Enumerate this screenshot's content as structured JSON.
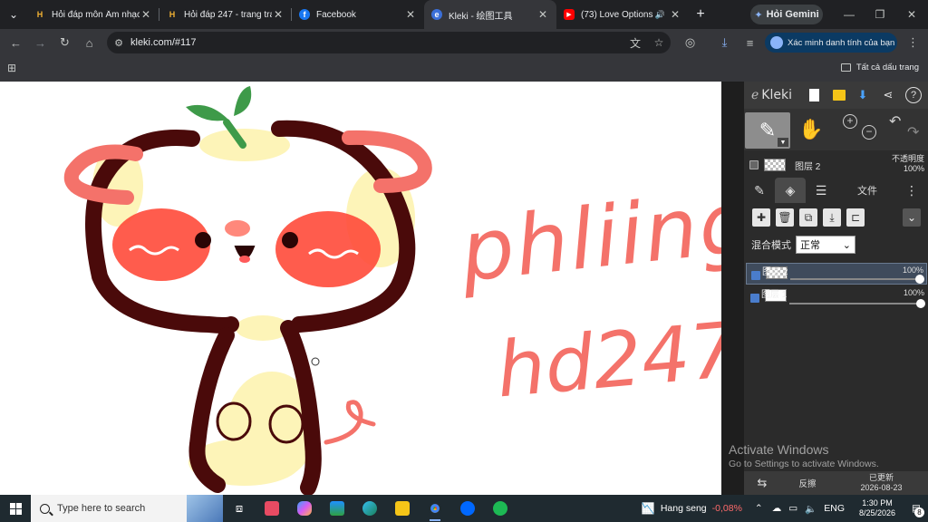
{
  "browser": {
    "tabs": [
      {
        "label": "Hỏi đáp môn Âm nhạc",
        "favicon": "hoidap-logo-icon"
      },
      {
        "label": "Hỏi đáp 247 - trang tra",
        "favicon": "hoidap-logo-icon"
      },
      {
        "label": "Facebook",
        "favicon": "facebook-icon"
      },
      {
        "label": "Kleki - 绘图工具",
        "favicon": "kleki-icon",
        "active": true
      },
      {
        "label": "(73) Love Options (",
        "favicon": "youtube-icon",
        "audio": true
      }
    ],
    "gemini_label": "Hỏi Gemini",
    "url": "kleki.com/#117",
    "verify_label": "Xác minh danh tính của bạn",
    "bookmarks_all": "Tất cả dấu trang"
  },
  "canvas": {
    "handwriting_line1": "phliing",
    "handwriting_line2": "hd247"
  },
  "kleki": {
    "logo": "Kleki",
    "current_layer": "图层 2",
    "opacity_label": "不透明度",
    "opacity_value": "100%",
    "file_tab": "文件",
    "blend_label": "混合模式",
    "blend_value": "正常",
    "layers": [
      {
        "name": "图层 2",
        "opacity": "100%",
        "selected": true
      },
      {
        "name": "图层 1",
        "opacity": "100%",
        "selected": false
      }
    ],
    "bottom_flip": "反擦",
    "bottom_updated": "已更新",
    "bottom_date": "2026-08-23"
  },
  "watermark": {
    "line1": "Activate Windows",
    "line2": "Go to Settings to activate Windows."
  },
  "taskbar": {
    "search_placeholder": "Type here to search",
    "stock_name": "Hang seng",
    "stock_change": "-0,08%",
    "lang": "ENG",
    "time": "1:30 PM",
    "date": "8/25/2026",
    "notif_count": "8"
  },
  "colors": {
    "accent": "#8ab4f8",
    "stroke_dark": "#4a0a0a",
    "blush": "#ff4a3a",
    "ear_pink": "#f4726a",
    "cream": "#fdf4b8",
    "text_salmon": "#f4726a",
    "leaf": "#3e9a49",
    "stock_negative": "#ff6b6b"
  }
}
